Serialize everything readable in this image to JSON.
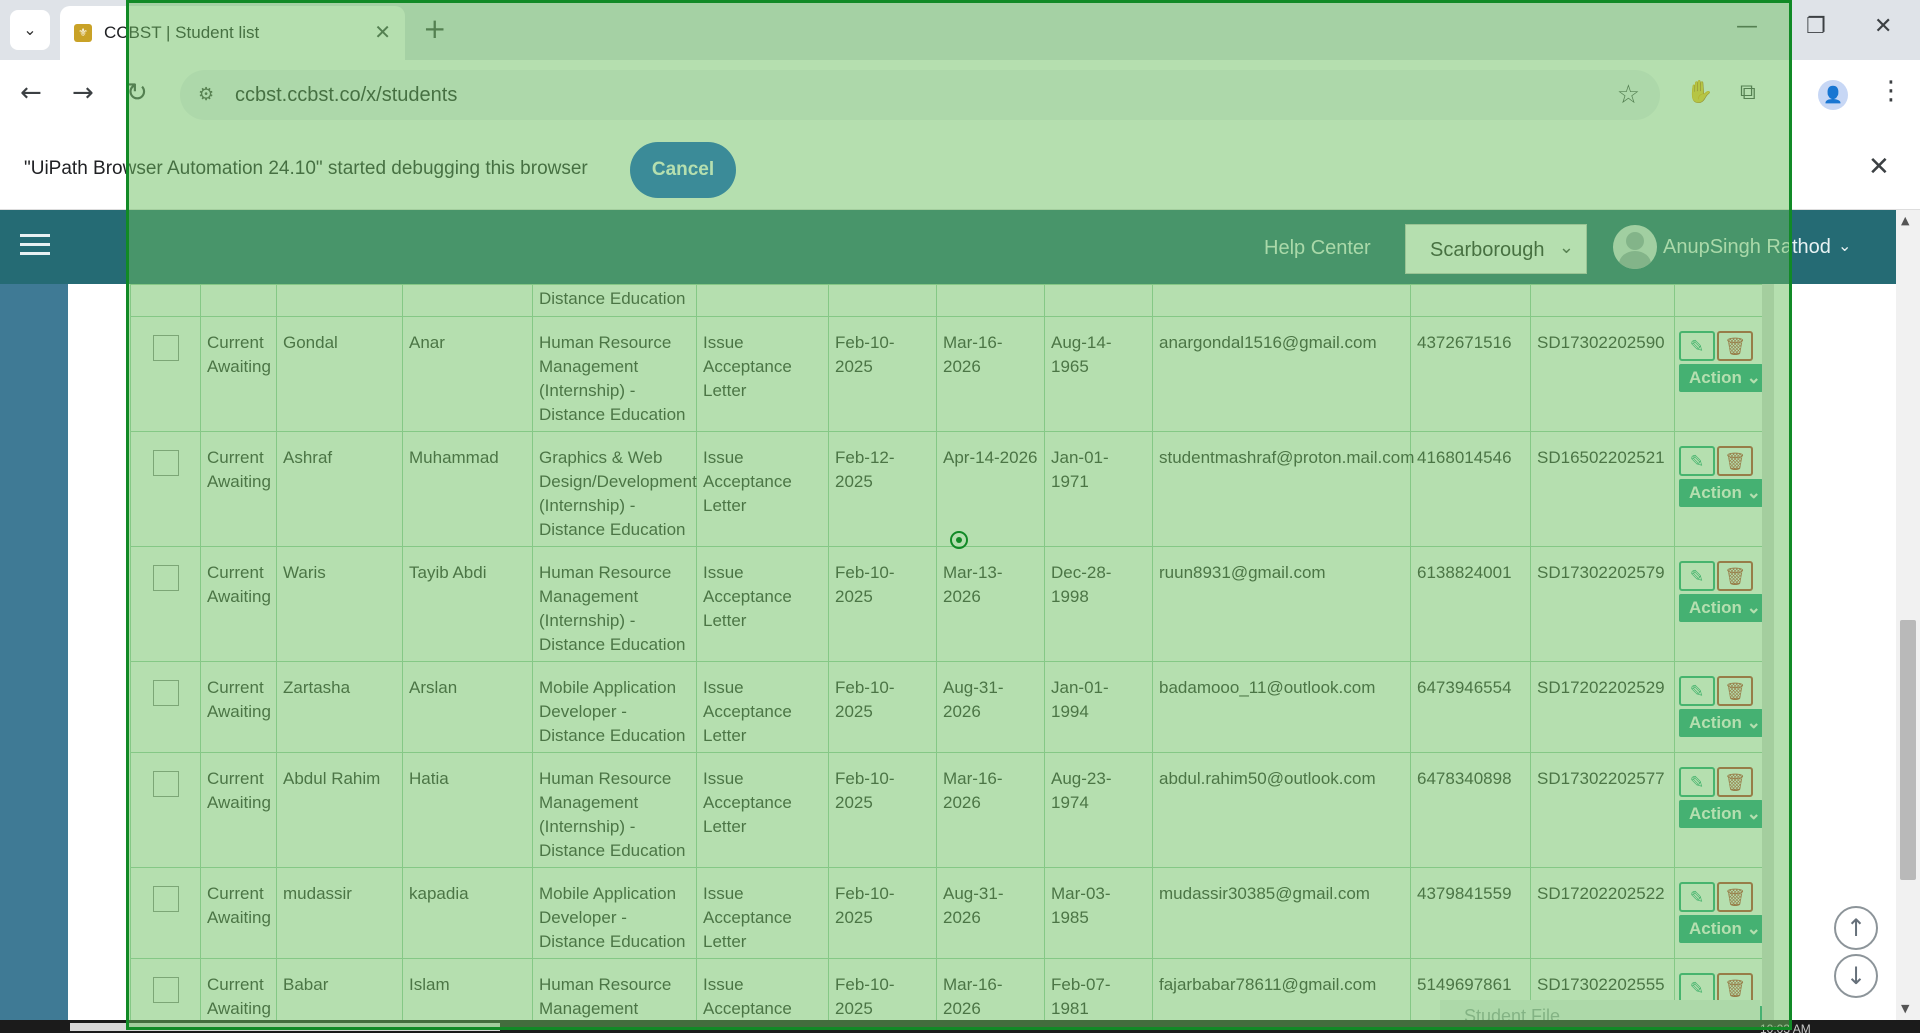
{
  "browser": {
    "tab_title": "CCBST | Student list",
    "url": "ccbst.ccbst.co/x/students",
    "infobar_text": "\"UiPath Browser Automation 24.10\" started debugging this browser",
    "infobar_cancel": "Cancel"
  },
  "icons": {
    "tab_search": "⌄",
    "tab_close": "✕",
    "new_tab": "+",
    "minimize": "—",
    "restore": "❐",
    "close": "✕",
    "back": "←",
    "forward": "→",
    "reload": "↻",
    "site_info": "⚙",
    "bookmark": "☆",
    "ext_red": "✋",
    "extensions": "⧉",
    "profile": "👤",
    "menu": "⋮",
    "infobar_close": "✕",
    "select_chev": "⌄",
    "user_chev": "⌄",
    "edit": "✎",
    "delete": "🗑",
    "scroll_up": "↑",
    "scroll_down": "↓",
    "sb_up": "▲",
    "sb_down": "▼"
  },
  "app": {
    "help_center": "Help Center",
    "branch": "Scarborough",
    "user_name": "AnupSingh Rathod",
    "student_file_label": "Student File",
    "clock_partial": "10:03 AM"
  },
  "table": {
    "top_partial_program": "Distance Education",
    "action_label": "Action ⌄",
    "rows": [
      {
        "status": "Current Awaiting",
        "last": "Gondal",
        "first": "Anar",
        "program": "Human Resource Management (Internship) - Distance Education",
        "task": "Issue Acceptance Letter",
        "start": "Feb-10-2025",
        "end": "Mar-16-2026",
        "dob": "Aug-14-1965",
        "email": "anargondal1516@gmail.com",
        "phone": "4372671516",
        "sid": "SD17302202590"
      },
      {
        "status": "Current Awaiting",
        "last": "Ashraf",
        "first": "Muhammad",
        "program": "Graphics & Web Design/Development (Internship) - Distance Education",
        "task": "Issue Acceptance Letter",
        "start": "Feb-12-2025",
        "end": "Apr-14-2026",
        "dob": "Jan-01-1971",
        "email": "studentmashraf@proton.mail.com",
        "phone": "4168014546",
        "sid": "SD16502202521"
      },
      {
        "status": "Current Awaiting",
        "last": "Waris",
        "first": "Tayib Abdi",
        "program": "Human Resource Management (Internship) - Distance Education",
        "task": "Issue Acceptance Letter",
        "start": "Feb-10-2025",
        "end": "Mar-13-2026",
        "dob": "Dec-28-1998",
        "email": "ruun8931@gmail.com",
        "phone": "6138824001",
        "sid": "SD17302202579"
      },
      {
        "status": "Current Awaiting",
        "last": "Zartasha",
        "first": "Arslan",
        "program": "Mobile Application Developer - Distance Education",
        "task": "Issue Acceptance Letter",
        "start": "Feb-10-2025",
        "end": "Aug-31-2026",
        "dob": "Jan-01-1994",
        "email": "badamooo_11@outlook.com",
        "phone": "6473946554",
        "sid": "SD17202202529"
      },
      {
        "status": "Current Awaiting",
        "last": "Abdul Rahim",
        "first": "Hatia",
        "program": "Human Resource Management (Internship) - Distance Education",
        "task": "Issue Acceptance Letter",
        "start": "Feb-10-2025",
        "end": "Mar-16-2026",
        "dob": "Aug-23-1974",
        "email": "abdul.rahim50@outlook.com",
        "phone": "6478340898",
        "sid": "SD17302202577"
      },
      {
        "status": "Current Awaiting",
        "last": "mudassir",
        "first": "kapadia",
        "program": "Mobile Application Developer - Distance Education",
        "task": "Issue Acceptance Letter",
        "start": "Feb-10-2025",
        "end": "Aug-31-2026",
        "dob": "Mar-03-1985",
        "email": "mudassir30385@gmail.com",
        "phone": "4379841559",
        "sid": "SD17202202522"
      },
      {
        "status": "Current Awaiting",
        "last": "Babar",
        "first": "Islam",
        "program": "Human Resource Management (Internship) - Distance Education",
        "task": "Issue Acceptance Letter",
        "start": "Feb-10-2025",
        "end": "Mar-16-2026",
        "dob": "Feb-07-1981",
        "email": "fajarbabar78611@gmail.com",
        "phone": "5149697861",
        "sid": "SD17302202555"
      }
    ]
  }
}
